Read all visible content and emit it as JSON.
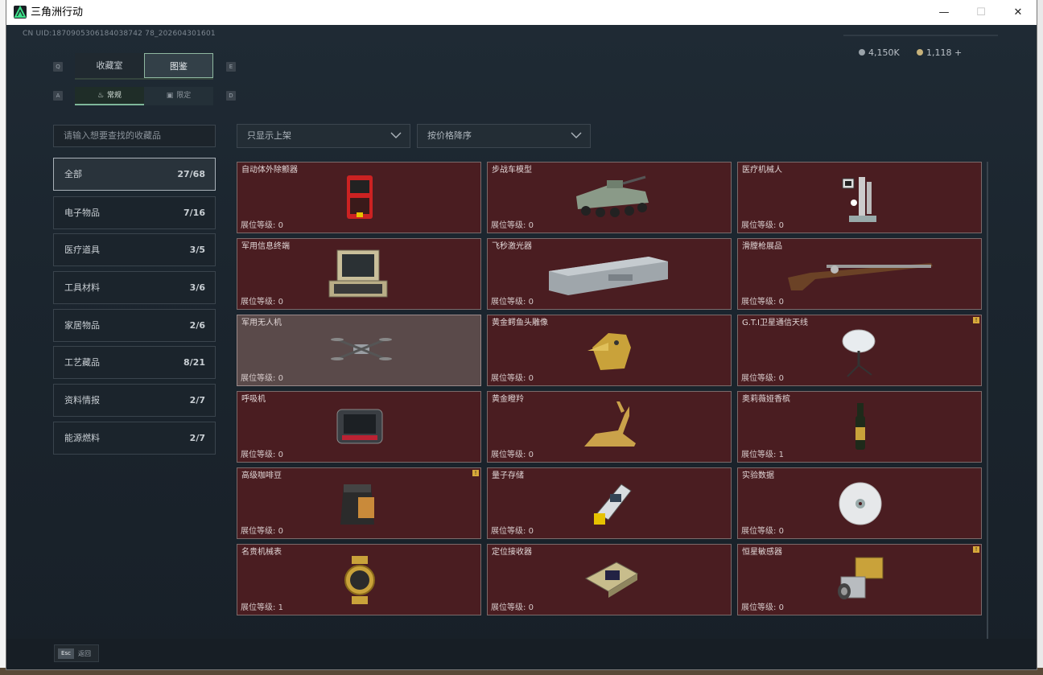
{
  "window": {
    "title": "三角洲行动",
    "min": "—",
    "max": "☐",
    "close": "✕"
  },
  "header": {
    "uid": "CN UID:1870905306184038742 78_202604301601",
    "currency": [
      {
        "value": "4,150K"
      },
      {
        "value": "1,118 +"
      }
    ]
  },
  "keys": {
    "q": "Q",
    "e": "E",
    "a": "A",
    "d": "D"
  },
  "tabs": [
    {
      "label": "收藏室"
    },
    {
      "label": "图鉴"
    }
  ],
  "subtabs": [
    {
      "label": "常规"
    },
    {
      "label": "限定"
    }
  ],
  "search": {
    "placeholder": "请输入想要查找的收藏品"
  },
  "categories": [
    {
      "name": "全部",
      "count": "27/68"
    },
    {
      "name": "电子物品",
      "count": "7/16"
    },
    {
      "name": "医疗道具",
      "count": "3/5"
    },
    {
      "name": "工具材料",
      "count": "3/6"
    },
    {
      "name": "家居物品",
      "count": "2/6"
    },
    {
      "name": "工艺藏品",
      "count": "8/21"
    },
    {
      "name": "资料情报",
      "count": "2/7"
    },
    {
      "name": "能源燃料",
      "count": "2/7"
    }
  ],
  "filters": {
    "filter": "只显示上架",
    "sort": "按价格降序"
  },
  "level_label": "展位等级:",
  "items": [
    {
      "name": "自动体外除颤器",
      "level": "0",
      "icon": "defibrillator-icon"
    },
    {
      "name": "步战车模型",
      "level": "0",
      "icon": "ifv-model-icon"
    },
    {
      "name": "医疗机械人",
      "level": "0",
      "icon": "medical-robot-icon"
    },
    {
      "name": "军用信息终端",
      "level": "0",
      "icon": "military-terminal-icon"
    },
    {
      "name": "飞秒激光器",
      "level": "0",
      "icon": "laser-case-icon"
    },
    {
      "name": "滑膛枪展品",
      "level": "0",
      "icon": "musket-icon"
    },
    {
      "name": "军用无人机",
      "level": "0",
      "icon": "drone-icon"
    },
    {
      "name": "黄金鳄鱼头雕像",
      "level": "0",
      "icon": "gold-crocodile-icon"
    },
    {
      "name": "G.T.I卫星通信天线",
      "level": "0",
      "icon": "satellite-dish-icon",
      "warn": "!"
    },
    {
      "name": "呼吸机",
      "level": "0",
      "icon": "ventilator-icon"
    },
    {
      "name": "黄金瞪羚",
      "level": "0",
      "icon": "gold-gazelle-icon"
    },
    {
      "name": "奥莉薇娅香槟",
      "level": "1",
      "icon": "champagne-icon"
    },
    {
      "name": "高级咖啡豆",
      "level": "0",
      "icon": "coffee-bag-icon",
      "warn": "!"
    },
    {
      "name": "量子存储",
      "level": "0",
      "icon": "quantum-storage-icon"
    },
    {
      "name": "实验数据",
      "level": "0",
      "icon": "data-disc-icon"
    },
    {
      "name": "名贵机械表",
      "level": "1",
      "icon": "watch-icon"
    },
    {
      "name": "定位接收器",
      "level": "0",
      "icon": "gps-receiver-icon"
    },
    {
      "name": "恒星敏感器",
      "level": "0",
      "icon": "star-sensor-icon",
      "warn": "!"
    }
  ],
  "footer": {
    "esc_key": "Esc",
    "esc_label": "返回"
  },
  "colors": {
    "card_bg": "#4a1d21",
    "card_border": "#7b6a6a",
    "accent_green": "#7fb79a",
    "warn": "#d8a93a"
  }
}
